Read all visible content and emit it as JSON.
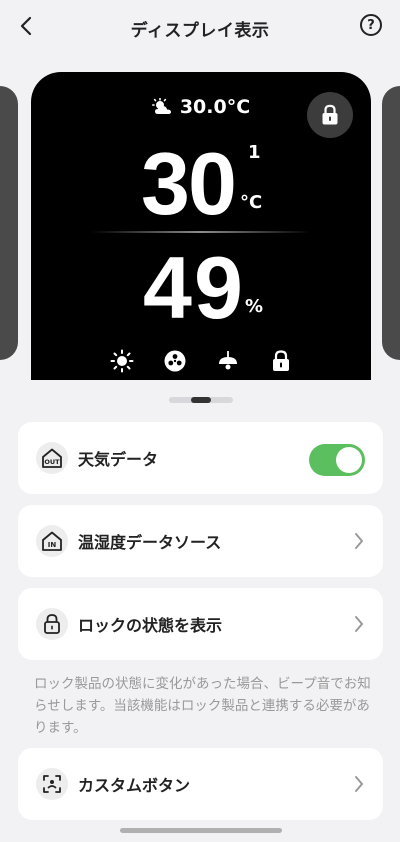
{
  "header": {
    "title": "ディスプレイ表示",
    "help_label": "?"
  },
  "device": {
    "weather": {
      "icon": "partly-cloudy-icon",
      "outside_temp": "30.0°C"
    },
    "temperature": {
      "value": "30",
      "decimal": "1",
      "unit": "°C"
    },
    "humidity": {
      "value": "49",
      "unit": "%"
    },
    "bottom_icons": [
      "sun-icon",
      "fan-icon",
      "lamp-icon",
      "lock-icon"
    ]
  },
  "settings": {
    "weather_data": {
      "label": "天気データ",
      "icon_text": "OUT",
      "enabled": true
    },
    "temp_source": {
      "label": "温湿度データソース",
      "icon_text": "IN"
    },
    "lock_status": {
      "label": "ロックの状態を表示"
    },
    "lock_note": "ロック製品の状態に変化があった場合、ビープ音でお知らせします。当該機能はロック製品と連携する必要があります。",
    "custom_button": {
      "label": "カスタムボタン"
    }
  },
  "colors": {
    "accent_green": "#5cbf5f",
    "device_bg": "#000000",
    "page_bg": "#f2f2f4"
  }
}
